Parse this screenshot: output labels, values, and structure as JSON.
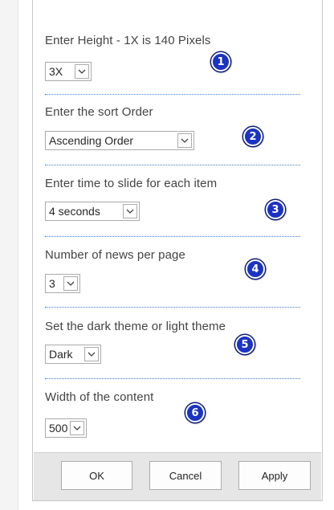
{
  "settings": [
    {
      "label": "Enter Height - 1X is 140 Pixels",
      "value": "3X",
      "badge": "1"
    },
    {
      "label": "Enter the sort Order",
      "value": "Ascending Order",
      "badge": "2"
    },
    {
      "label": "Enter time to slide for each item",
      "value": "4 seconds",
      "badge": "3"
    },
    {
      "label": "Number of news per page",
      "value": "3",
      "badge": "4"
    },
    {
      "label": "Set the dark theme or light theme",
      "value": "Dark",
      "badge": "5"
    },
    {
      "label": "Width of the content",
      "value": "500",
      "badge": "6"
    }
  ],
  "footer": {
    "ok_label": "OK",
    "cancel_label": "Cancel",
    "apply_label": "Apply"
  },
  "colors": {
    "badge": "#1b33c4",
    "separator": "#3b7fd1",
    "footer_bg": "#e6e6e6"
  },
  "icons": {
    "dropdown": "chevron-down-icon",
    "badge": "numbered-badge-icon"
  }
}
